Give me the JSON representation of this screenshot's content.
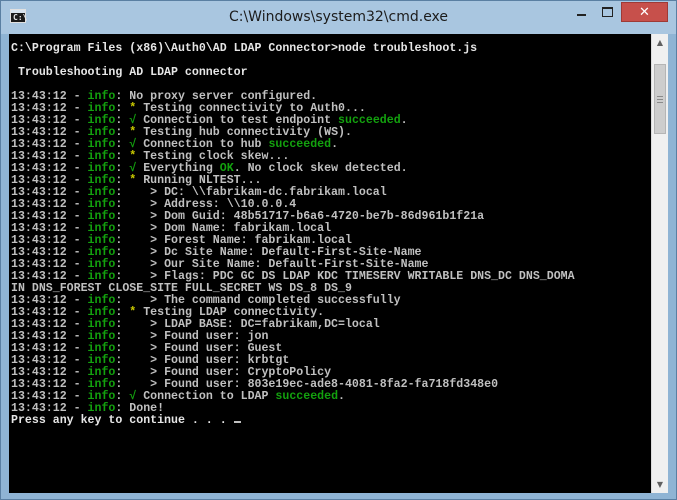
{
  "window": {
    "title": "C:\\Windows\\system32\\cmd.exe",
    "app_icon_glyph": "C:\\",
    "minimize_glyph": "",
    "maximize_glyph": "",
    "close_glyph": "✕"
  },
  "colors": {
    "console_bg": "#000000",
    "console_text": "#c0c0c0",
    "info_green": "#13a10e",
    "star_yellow": "#c9c900"
  },
  "scrollbar": {
    "up_glyph": "▲",
    "down_glyph": "▼"
  },
  "console": {
    "lines": [
      [
        {
          "t": "C:\\Program Files (x86)\\Auth0\\AD LDAP Connector>node troubleshoot.js",
          "c": "t-white"
        }
      ],
      [
        {
          "t": ""
        }
      ],
      [
        {
          "t": " Troubleshooting AD LDAP connector",
          "c": "t-white"
        }
      ],
      [
        {
          "t": ""
        }
      ],
      [
        {
          "t": "13:43:12 - "
        },
        {
          "t": "info",
          "c": "t-green"
        },
        {
          "t": ": No proxy server configured."
        }
      ],
      [
        {
          "t": "13:43:12 - "
        },
        {
          "t": "info",
          "c": "t-green"
        },
        {
          "t": ": "
        },
        {
          "t": "*",
          "c": "t-yellow"
        },
        {
          "t": " Testing connectivity to Auth0..."
        }
      ],
      [
        {
          "t": "13:43:12 - "
        },
        {
          "t": "info",
          "c": "t-green"
        },
        {
          "t": ": "
        },
        {
          "t": "√",
          "c": "t-green"
        },
        {
          "t": " Connection to test endpoint "
        },
        {
          "t": "succeeded",
          "c": "t-green"
        },
        {
          "t": "."
        }
      ],
      [
        {
          "t": "13:43:12 - "
        },
        {
          "t": "info",
          "c": "t-green"
        },
        {
          "t": ": "
        },
        {
          "t": "*",
          "c": "t-yellow"
        },
        {
          "t": " Testing hub connectivity (WS)."
        }
      ],
      [
        {
          "t": "13:43:12 - "
        },
        {
          "t": "info",
          "c": "t-green"
        },
        {
          "t": ": "
        },
        {
          "t": "√",
          "c": "t-green"
        },
        {
          "t": " Connection to hub "
        },
        {
          "t": "succeeded",
          "c": "t-green"
        },
        {
          "t": "."
        }
      ],
      [
        {
          "t": "13:43:12 - "
        },
        {
          "t": "info",
          "c": "t-green"
        },
        {
          "t": ": "
        },
        {
          "t": "*",
          "c": "t-yellow"
        },
        {
          "t": " Testing clock skew..."
        }
      ],
      [
        {
          "t": "13:43:12 - "
        },
        {
          "t": "info",
          "c": "t-green"
        },
        {
          "t": ": "
        },
        {
          "t": "√",
          "c": "t-green"
        },
        {
          "t": " Everything "
        },
        {
          "t": "OK",
          "c": "t-green"
        },
        {
          "t": ". No clock skew detected."
        }
      ],
      [
        {
          "t": "13:43:12 - "
        },
        {
          "t": "info",
          "c": "t-green"
        },
        {
          "t": ": "
        },
        {
          "t": "*",
          "c": "t-yellow"
        },
        {
          "t": " Running NLTEST..."
        }
      ],
      [
        {
          "t": "13:43:12 - "
        },
        {
          "t": "info",
          "c": "t-green"
        },
        {
          "t": ":    > DC: \\\\fabrikam-dc.fabrikam.local"
        }
      ],
      [
        {
          "t": "13:43:12 - "
        },
        {
          "t": "info",
          "c": "t-green"
        },
        {
          "t": ":    > Address: \\\\10.0.0.4"
        }
      ],
      [
        {
          "t": "13:43:12 - "
        },
        {
          "t": "info",
          "c": "t-green"
        },
        {
          "t": ":    > Dom Guid: 48b51717-b6a6-4720-be7b-86d961b1f21a"
        }
      ],
      [
        {
          "t": "13:43:12 - "
        },
        {
          "t": "info",
          "c": "t-green"
        },
        {
          "t": ":    > Dom Name: fabrikam.local"
        }
      ],
      [
        {
          "t": "13:43:12 - "
        },
        {
          "t": "info",
          "c": "t-green"
        },
        {
          "t": ":    > Forest Name: fabrikam.local"
        }
      ],
      [
        {
          "t": "13:43:12 - "
        },
        {
          "t": "info",
          "c": "t-green"
        },
        {
          "t": ":    > Dc Site Name: Default-First-Site-Name"
        }
      ],
      [
        {
          "t": "13:43:12 - "
        },
        {
          "t": "info",
          "c": "t-green"
        },
        {
          "t": ":    > Our Site Name: Default-First-Site-Name"
        }
      ],
      [
        {
          "t": "13:43:12 - "
        },
        {
          "t": "info",
          "c": "t-green"
        },
        {
          "t": ":    > Flags: PDC GC DS LDAP KDC TIMESERV WRITABLE DNS_DC DNS_DOMA"
        }
      ],
      [
        {
          "t": "IN DNS_FOREST CLOSE_SITE FULL_SECRET WS DS_8 DS_9"
        }
      ],
      [
        {
          "t": "13:43:12 - "
        },
        {
          "t": "info",
          "c": "t-green"
        },
        {
          "t": ":    > The command completed successfully"
        }
      ],
      [
        {
          "t": "13:43:12 - "
        },
        {
          "t": "info",
          "c": "t-green"
        },
        {
          "t": ": "
        },
        {
          "t": "*",
          "c": "t-yellow"
        },
        {
          "t": " Testing LDAP connectivity."
        }
      ],
      [
        {
          "t": "13:43:12 - "
        },
        {
          "t": "info",
          "c": "t-green"
        },
        {
          "t": ":    > LDAP BASE: DC=fabrikam,DC=local"
        }
      ],
      [
        {
          "t": "13:43:12 - "
        },
        {
          "t": "info",
          "c": "t-green"
        },
        {
          "t": ":    > Found user: jon"
        }
      ],
      [
        {
          "t": "13:43:12 - "
        },
        {
          "t": "info",
          "c": "t-green"
        },
        {
          "t": ":    > Found user: Guest"
        }
      ],
      [
        {
          "t": "13:43:12 - "
        },
        {
          "t": "info",
          "c": "t-green"
        },
        {
          "t": ":    > Found user: krbtgt"
        }
      ],
      [
        {
          "t": "13:43:12 - "
        },
        {
          "t": "info",
          "c": "t-green"
        },
        {
          "t": ":    > Found user: CryptoPolicy"
        }
      ],
      [
        {
          "t": "13:43:12 - "
        },
        {
          "t": "info",
          "c": "t-green"
        },
        {
          "t": ":    > Found user: 803e19ec-ade8-4081-8fa2-fa718fd348e0"
        }
      ],
      [
        {
          "t": "13:43:12 - "
        },
        {
          "t": "info",
          "c": "t-green"
        },
        {
          "t": ": "
        },
        {
          "t": "√",
          "c": "t-green"
        },
        {
          "t": " Connection to LDAP "
        },
        {
          "t": "succeeded",
          "c": "t-green"
        },
        {
          "t": "."
        }
      ],
      [
        {
          "t": "13:43:12 - "
        },
        {
          "t": "info",
          "c": "t-green"
        },
        {
          "t": ": Done!"
        }
      ],
      [
        {
          "t": "Press any key to continue . . . ",
          "c": "t-white"
        },
        {
          "cursor": true
        }
      ]
    ]
  }
}
